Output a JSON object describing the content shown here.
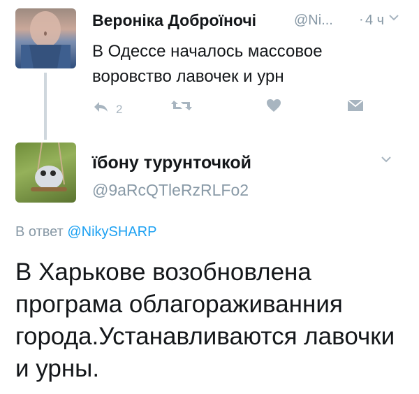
{
  "tweet1": {
    "author_name": "Вероніка Доброїночі",
    "author_handle": "@Ni...",
    "dot": "·",
    "time": "4 ч",
    "text": "В Одессе началось массовое воровство лавочек и урн",
    "reply_count": "2",
    "icons": [
      "reply-icon",
      "retweet-icon",
      "like-icon",
      "dm-icon",
      "chevron-down-icon"
    ]
  },
  "tweet2": {
    "author_name": "їбону турунточкой",
    "author_handle": "@9aRcQTleRzRLFo2",
    "reply_prefix": "В ответ",
    "reply_to": "@NikySHARP",
    "text": "В Харькове возобновлена програма облагораживанния города.Устанавливаются лавочки и урны."
  },
  "colors": {
    "text": "#14171a",
    "muted": "#8899a6",
    "icon": "#a8b5c0",
    "link": "#1da1f2"
  }
}
